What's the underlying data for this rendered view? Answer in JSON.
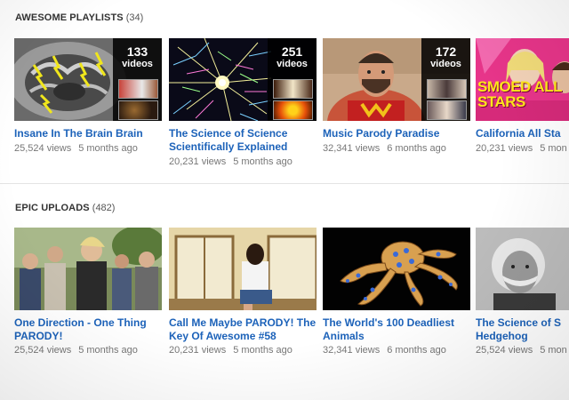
{
  "sections": [
    {
      "name": "AWESOME PLAYLISTS",
      "count": "(34)",
      "items": [
        {
          "title": "Insane In The Brain Brain",
          "views": "25,524 views",
          "ago": "5 months ago",
          "video_count": "133",
          "video_label": "videos"
        },
        {
          "title": "The Science of Science Scientifically Explained",
          "views": "20,231 views",
          "ago": "5 months ago",
          "video_count": "251",
          "video_label": "videos"
        },
        {
          "title": "Music Parody Paradise",
          "views": "32,341 views",
          "ago": "6 months ago",
          "video_count": "172",
          "video_label": "videos"
        },
        {
          "title": "California All Sta",
          "views": "20,231 views",
          "ago": "5 mon",
          "thumb_text": "SMOED ALL STARS"
        }
      ]
    },
    {
      "name": "EPIC UPLOADS",
      "count": "(482)",
      "items": [
        {
          "title": "One Direction - One Thing PARODY!",
          "views": "25,524 views",
          "ago": "5 months ago"
        },
        {
          "title": "Call Me Maybe PARODY! The Key Of Awesome #58",
          "views": "20,231 views",
          "ago": "5 months ago"
        },
        {
          "title": "The World's 100 Deadliest Animals",
          "views": "32,341 views",
          "ago": "6 months ago"
        },
        {
          "title": "The Science of S Hedgehog",
          "views": "25,524 views",
          "ago": "5 mon"
        }
      ]
    }
  ],
  "colors": {
    "link": "#1c62b9",
    "meta": "#777777",
    "header": "#333333"
  }
}
